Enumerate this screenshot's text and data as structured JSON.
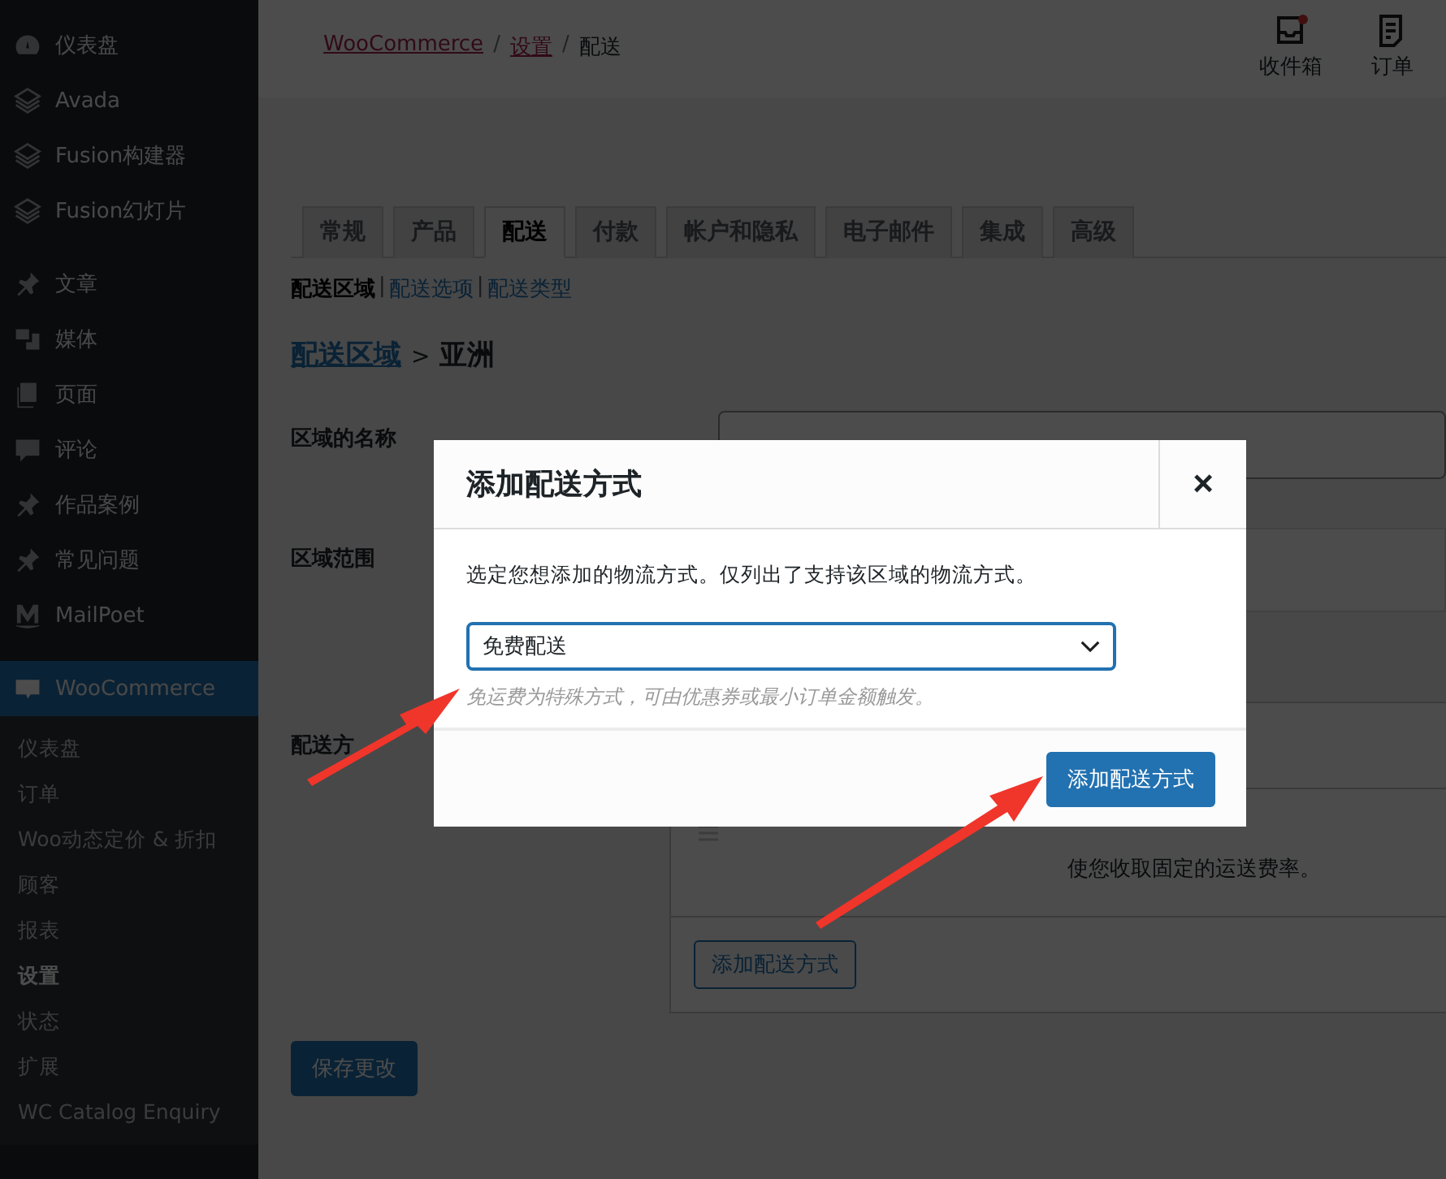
{
  "sidebar": {
    "items": [
      {
        "label": "仪表盘",
        "selected": false
      },
      {
        "label": "Avada",
        "selected": false
      },
      {
        "label": "Fusion构建器",
        "selected": false
      },
      {
        "label": "Fusion幻灯片",
        "selected": false
      },
      {
        "label": "文章",
        "selected": false
      },
      {
        "label": "媒体",
        "selected": false
      },
      {
        "label": "页面",
        "selected": false
      },
      {
        "label": "评论",
        "selected": false
      },
      {
        "label": "作品案例",
        "selected": false
      },
      {
        "label": "常见问题",
        "selected": false
      },
      {
        "label": "MailPoet",
        "selected": false
      },
      {
        "label": "WooCommerce",
        "selected": true,
        "children": [
          {
            "label": "仪表盘",
            "selected": false
          },
          {
            "label": "订单",
            "selected": false
          },
          {
            "label": "Woo动态定价 & 折扣",
            "selected": false
          },
          {
            "label": "顾客",
            "selected": false
          },
          {
            "label": "报表",
            "selected": false
          },
          {
            "label": "设置",
            "selected": true
          },
          {
            "label": "状态",
            "selected": false
          },
          {
            "label": "扩展",
            "selected": false
          },
          {
            "label": "WC Catalog Enquiry",
            "selected": false
          }
        ]
      }
    ]
  },
  "breadcrumb": [
    {
      "label": "WooCommerce",
      "kind": "link"
    },
    {
      "label": "/",
      "kind": "separator"
    },
    {
      "label": "设置",
      "kind": "link"
    },
    {
      "label": "/",
      "kind": "separator"
    },
    {
      "label": "配送",
      "kind": "current"
    }
  ],
  "header_actions": [
    {
      "label": "收件箱",
      "unread": true
    },
    {
      "label": "订单",
      "unread": false
    }
  ],
  "tabs": [
    {
      "label": "常规",
      "selected": false
    },
    {
      "label": "产品",
      "selected": false
    },
    {
      "label": "配送",
      "selected": true
    },
    {
      "label": "付款",
      "selected": false
    },
    {
      "label": "帐户和隐私",
      "selected": false
    },
    {
      "label": "电子邮件",
      "selected": false
    },
    {
      "label": "集成",
      "selected": false
    },
    {
      "label": "高级",
      "selected": false
    }
  ],
  "subtabs": [
    {
      "label": "配送区域",
      "selected": true
    },
    {
      "label": "配送选项",
      "selected": false
    },
    {
      "label": "配送类型",
      "selected": false
    }
  ],
  "subtab_separator": "|",
  "heading": {
    "link": "配送区域",
    "separator": ">",
    "current": "亚洲"
  },
  "form": {
    "zone_name_label": "区域的名称",
    "zone_region_label": "区域范围",
    "methods_label": "配送方",
    "method_description": "使您收取固定的运送费率。",
    "add_method_button": "添加配送方式"
  },
  "save_button": "保存更改",
  "modal": {
    "title": "添加配送方式",
    "close": "×",
    "description": "选定您想添加的物流方式。仅列出了支持该区域的物流方式。",
    "select_value": "免费配送",
    "hint": "免运费为特殊方式，可由优惠券或最小订单金额触发。",
    "submit": "添加配送方式"
  }
}
